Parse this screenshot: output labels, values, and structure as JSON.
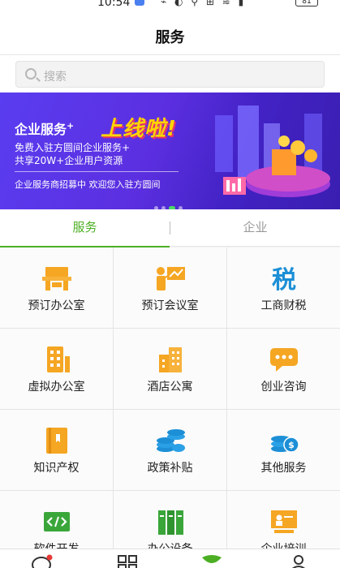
{
  "status_bar": {
    "time": "10:54",
    "battery": "81"
  },
  "header": {
    "title": "服务"
  },
  "search": {
    "placeholder": "搜索"
  },
  "banner": {
    "title": "企业服务",
    "title_sup": "+",
    "headline": "上线啦!",
    "line1": "免费入驻方圆间企业服务+",
    "line2": "共享20W+企业用户资源",
    "footer": "企业服务商招募中  欢迎您入驻方圆间",
    "accent_color": "#ffd400"
  },
  "tabs": [
    {
      "label": "服务",
      "active": true
    },
    {
      "label": "企业",
      "active": false
    }
  ],
  "services": [
    {
      "label": "预订办公室",
      "icon": "office-desk-icon"
    },
    {
      "label": "预订会议室",
      "icon": "meeting-presentation-icon"
    },
    {
      "label": "工商财税",
      "icon": "tax-character-icon"
    },
    {
      "label": "虚拟办公室",
      "icon": "virtual-office-building-icon"
    },
    {
      "label": "酒店公寓",
      "icon": "hotel-apartment-icon"
    },
    {
      "label": "创业咨询",
      "icon": "consult-chat-icon"
    },
    {
      "label": "知识产权",
      "icon": "intellectual-property-book-icon"
    },
    {
      "label": "政策补贴",
      "icon": "policy-subsidy-coins-icon"
    },
    {
      "label": "其他服务",
      "icon": "other-service-money-icon"
    },
    {
      "label": "软件开发",
      "icon": "software-code-icon"
    },
    {
      "label": "办公设备",
      "icon": "office-equipment-icon"
    },
    {
      "label": "企业培训",
      "icon": "enterprise-training-icon"
    }
  ],
  "colors": {
    "brand_green": "#4caf23",
    "icon_orange": "#f5a623",
    "icon_blue": "#1c8fd6",
    "icon_green": "#3aa63a"
  }
}
